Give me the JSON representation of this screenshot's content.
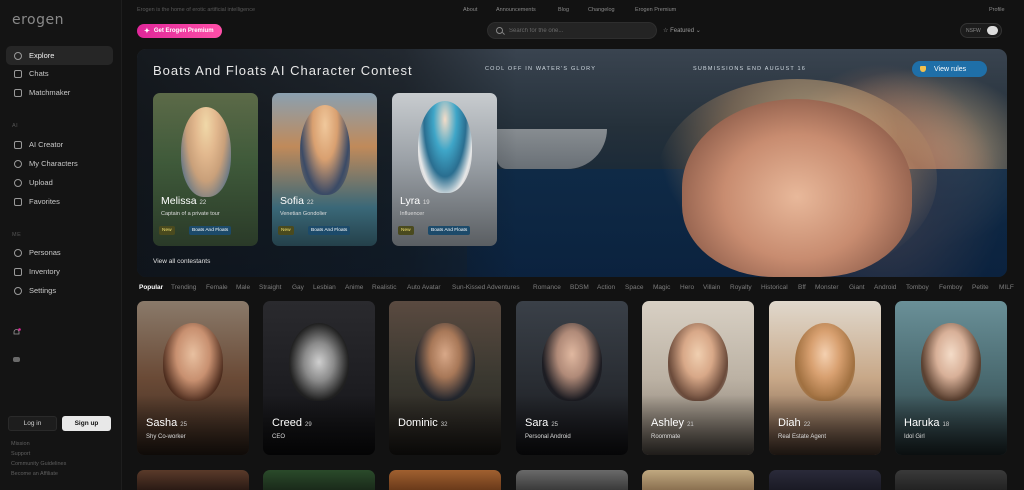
{
  "app": {
    "logo": "erogen",
    "tagline": "Erogen is the home of erotic artificial intelligence"
  },
  "topnav": {
    "links": [
      "About",
      "Announcements",
      "Blog",
      "Changelog",
      "Erogen Premium"
    ],
    "profile": "Profile"
  },
  "premium_button": "Get Erogen Premium",
  "search": {
    "placeholder": "Search for the one..."
  },
  "sort": {
    "label": "Featured"
  },
  "nsfw_toggle": {
    "label": "NSFW",
    "on": true
  },
  "sidebar": {
    "primary": [
      "Explore",
      "Chats",
      "Matchmaker"
    ],
    "section_ai": "AI",
    "ai_items": [
      "AI Creator",
      "My Characters",
      "Upload",
      "Favorites"
    ],
    "section_me": "ME",
    "me_items": [
      "Personas",
      "Inventory",
      "Settings"
    ],
    "login": "Log in",
    "signup": "Sign up",
    "footer": [
      "Mission",
      "Support",
      "Community Guidelines",
      "Become an Affiliate"
    ]
  },
  "banner": {
    "title": "Boats And Floats AI Character Contest",
    "tagline": "COOL OFF IN WATER'S GLORY",
    "deadline": "SUBMISSIONS END AUGUST 16",
    "rules_button": "View rules",
    "view_all": "View all contestants",
    "contestants": [
      {
        "name": "Melissa",
        "age": "22",
        "desc": "Captain of a private tour",
        "badge_new": "New",
        "badge_theme": "Boats And Floats"
      },
      {
        "name": "Sofia",
        "age": "22",
        "desc": "Venetian Gondolier",
        "badge_new": "New",
        "badge_theme": "Boats And Floats"
      },
      {
        "name": "Lyra",
        "age": "19",
        "desc": "Influencer",
        "badge_new": "New",
        "badge_theme": "Boats And Floats"
      }
    ]
  },
  "categories": [
    "Popular",
    "Trending",
    "Female",
    "Male",
    "Straight",
    "Gay",
    "Lesbian",
    "Anime",
    "Realistic",
    "Auto Avatar",
    "Sun-Kissed Adventures",
    "Romance",
    "BDSM",
    "Action",
    "Space",
    "Magic",
    "Hero",
    "Villain",
    "Royalty",
    "Historical",
    "Bff",
    "Monster",
    "Giant",
    "Android",
    "Tomboy",
    "Femboy",
    "Petite",
    "MILF"
  ],
  "characters": [
    {
      "name": "Sasha",
      "age": "25",
      "desc": "Shy Co-worker"
    },
    {
      "name": "Creed",
      "age": "29",
      "desc": "CEO"
    },
    {
      "name": "Dominic",
      "age": "32",
      "desc": ""
    },
    {
      "name": "Sara",
      "age": "25",
      "desc": "Personal Android"
    },
    {
      "name": "Ashley",
      "age": "21",
      "desc": "Roommate"
    },
    {
      "name": "Diah",
      "age": "22",
      "desc": "Real Estate Agent"
    },
    {
      "name": "Haruka",
      "age": "18",
      "desc": "Idol Girl"
    }
  ],
  "colors": {
    "accent_pink": "#e0279a",
    "accent_blue": "#1f6fa8",
    "bg": "#121212"
  }
}
